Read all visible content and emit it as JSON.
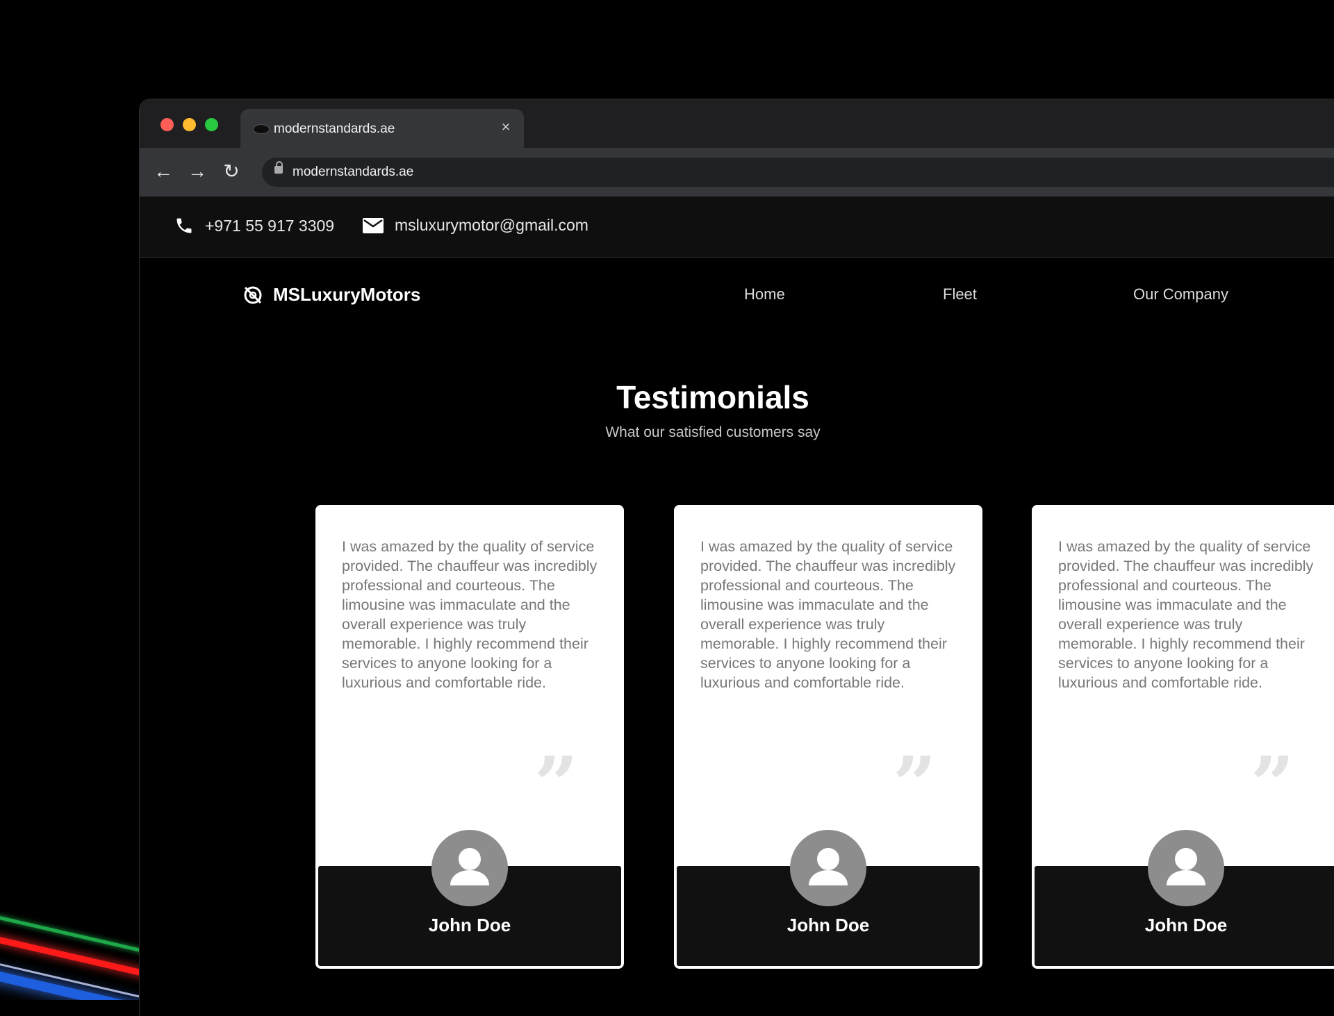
{
  "browser": {
    "tab_title": "modernstandards.ae",
    "tab_close": "×",
    "url": "modernstandards.ae",
    "nav": {
      "back": "←",
      "forward": "→",
      "reload": "↻"
    }
  },
  "topbar": {
    "phone": "+971 55 917 3309",
    "email": "msluxurymotor@gmail.com"
  },
  "navbar": {
    "brand": "MSLuxuryMotors",
    "links": [
      "Home",
      "Fleet",
      "Our Company"
    ]
  },
  "testimonials": {
    "title": "Testimonials",
    "subtitle": "What our satisfied customers say",
    "cards": [
      {
        "text": "I was amazed by the quality of service provided. The chauffeur was incredibly professional and courteous. The limousine was immaculate and the overall experience was truly memorable. I highly recommend their services to anyone looking for a luxurious and comfortable ride.",
        "author": "John Doe"
      },
      {
        "text": "I was amazed by the quality of service provided. The chauffeur was incredibly professional and courteous. The limousine was immaculate and the overall experience was truly memorable. I highly recommend their services to anyone looking for a luxurious and comfortable ride.",
        "author": "John Doe"
      },
      {
        "text": "I was amazed by the quality of service provided. The chauffeur was incredibly professional and courteous. The limousine was immaculate and the overall experience was truly memorable. I highly recommend their services to anyone looking for a luxurious and comfortable ride.",
        "author": "John Doe"
      }
    ]
  },
  "icons": {
    "phone": "phone-icon",
    "email": "mail-icon",
    "brand": "brand-logo-icon",
    "avatar": "user-avatar-icon",
    "quote": "quote-mark-icon"
  },
  "colors": {
    "page_bg": "#000000",
    "card_bg": "#ffffff",
    "card_footer": "#111111",
    "avatar": "#8d8d8d"
  }
}
